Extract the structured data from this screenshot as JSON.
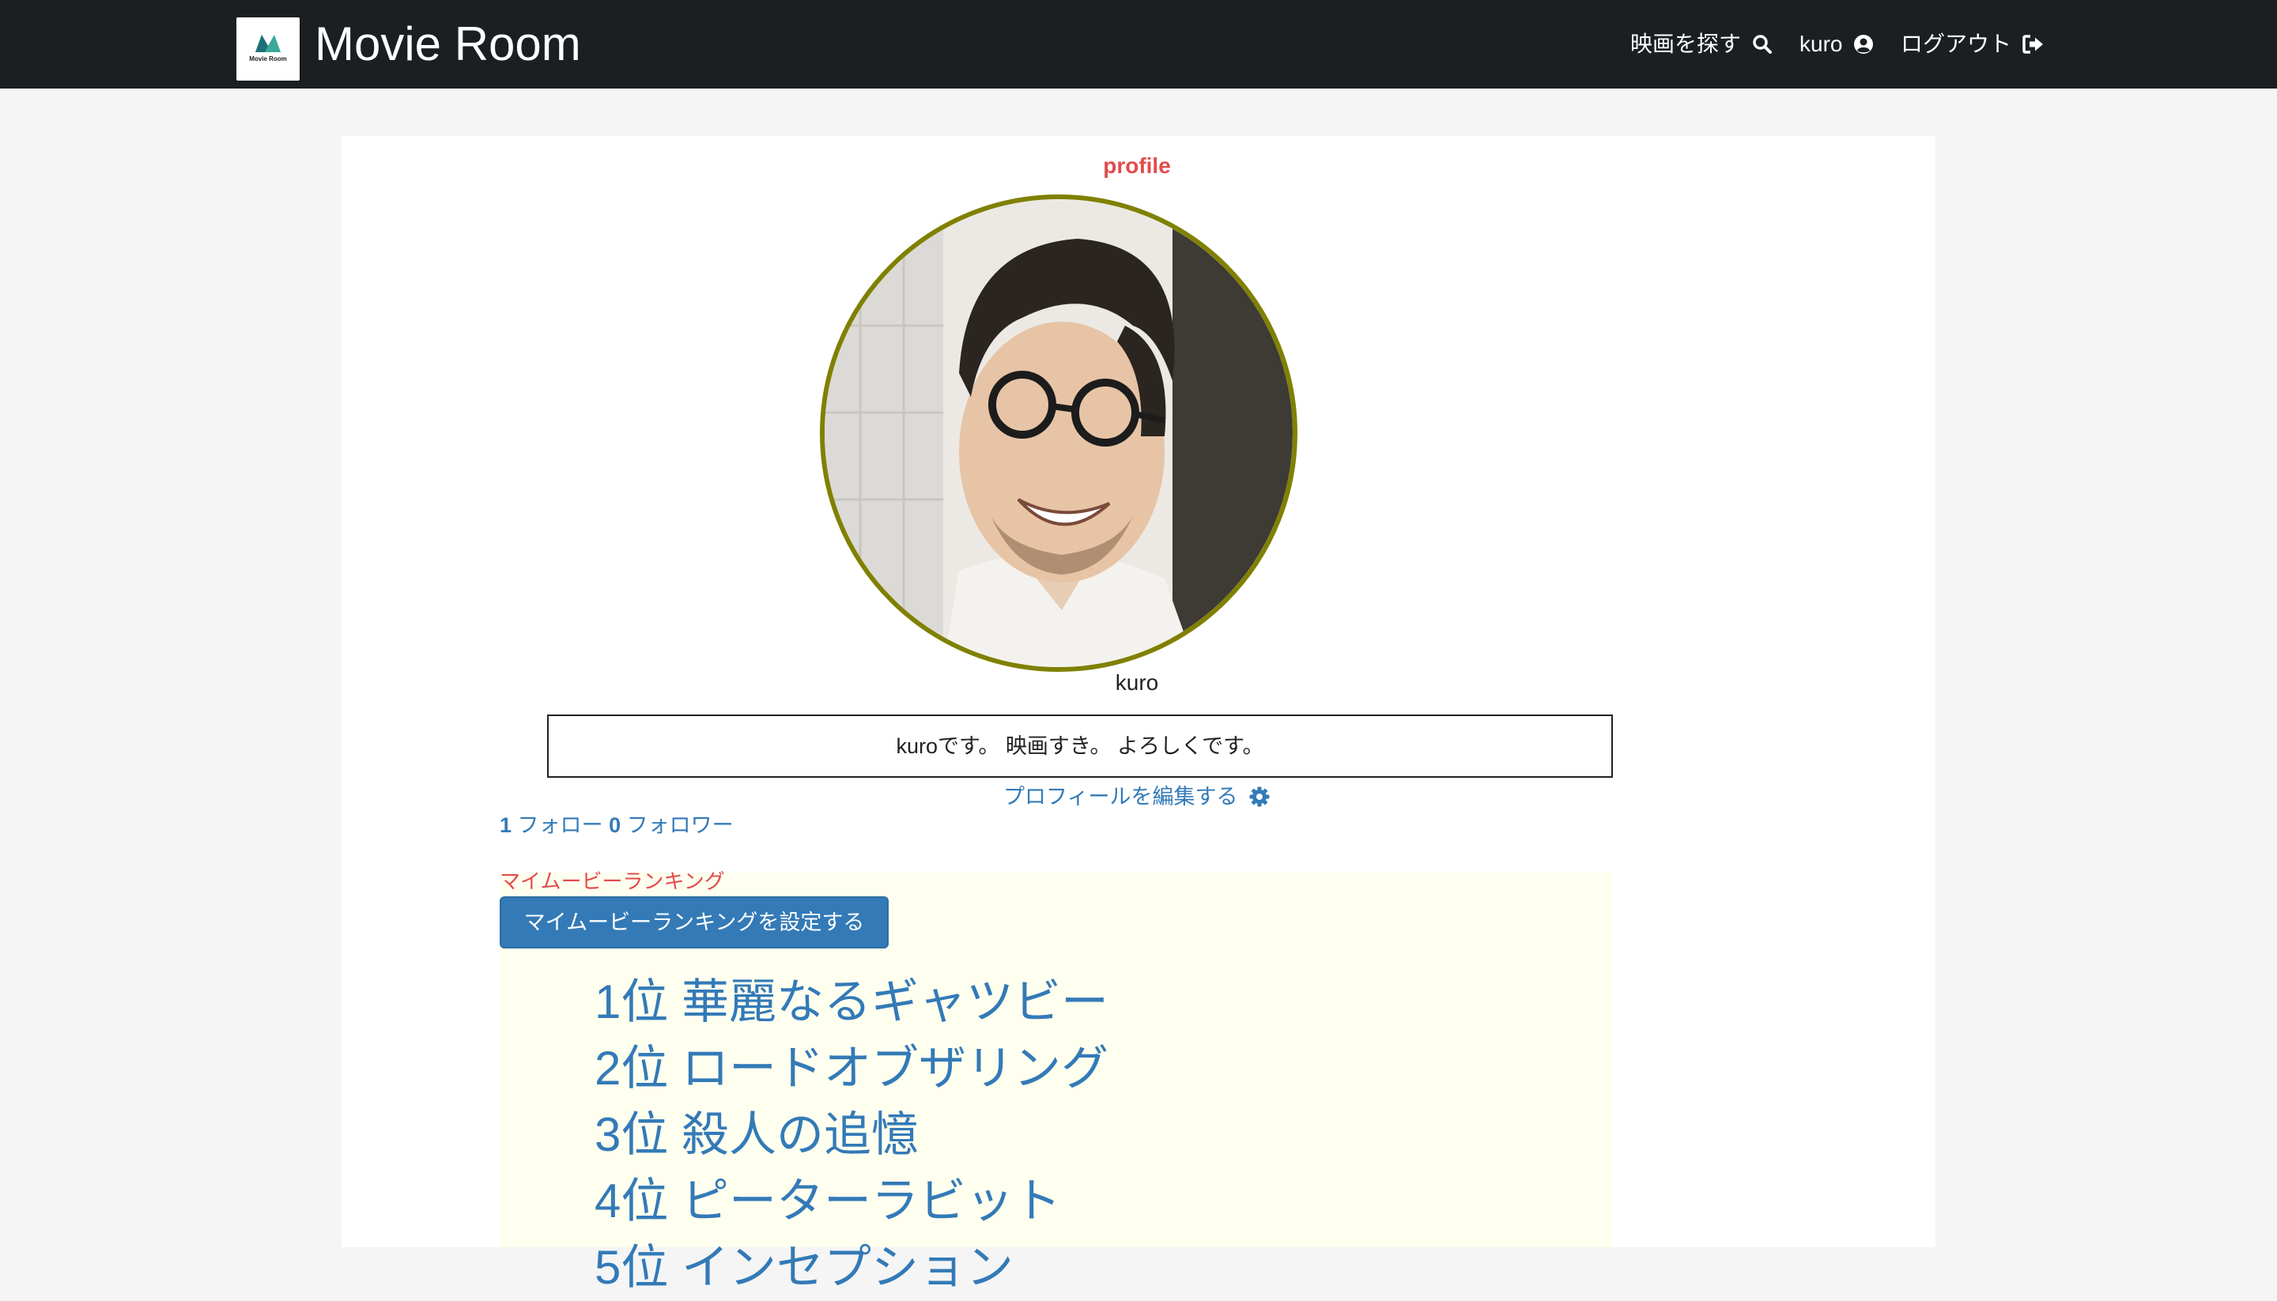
{
  "navbar": {
    "logo_text": "Movie Room",
    "brand_title": "Movie Room",
    "search_label": "映画を探す",
    "user_label": "kuro",
    "logout_label": "ログアウト"
  },
  "profile": {
    "heading": "profile",
    "username": "kuro",
    "bio": "kuroです。 映画すき。 よろしくです。",
    "edit_label": "プロフィールを編集する",
    "follow_count": "1",
    "follow_label": "フォロー",
    "follower_count": "0",
    "follower_label": "フォロワー"
  },
  "ranking": {
    "heading": "マイムービーランキング",
    "set_button_label": "マイムービーランキングを設定する",
    "items": [
      "1位 華麗なるギャツビー",
      "2位 ロードオブザリング",
      "3位 殺人の追憶",
      "4位 ピーターラビット",
      "5位 インセプション"
    ]
  },
  "colors": {
    "navbar_bg": "#1b1f22",
    "link": "#337ab7",
    "heading_red": "#e34b4b",
    "avatar_border": "#808000",
    "ranking_bg": "#fffff0"
  },
  "icons": {
    "search": "search-icon",
    "user": "user-circle-icon",
    "logout": "sign-out-icon",
    "settings": "gear-icon"
  }
}
